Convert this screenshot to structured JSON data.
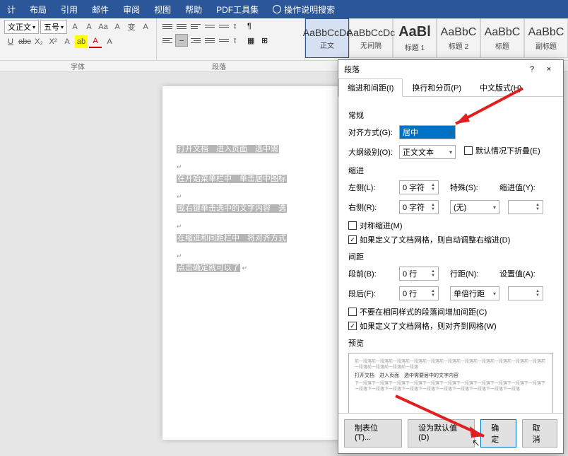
{
  "menu": {
    "items": [
      "计",
      "布局",
      "引用",
      "邮件",
      "审阅",
      "视图",
      "帮助",
      "PDF工具集"
    ],
    "search_hint": "操作说明搜索"
  },
  "ribbon": {
    "font_sel": "文正文",
    "size_sel": "五号",
    "btns_row1": [
      "A",
      "A",
      "Aa",
      "A",
      "变",
      "A"
    ],
    "btns_row2": [
      "U",
      "abc",
      "X₂",
      "X²",
      "A",
      "A",
      "A"
    ],
    "group_font": "字体",
    "group_para": "段落",
    "styles": [
      {
        "preview": "AaBbCcDc",
        "label": "正文",
        "big": false
      },
      {
        "preview": "AaBbCcDc",
        "label": "无间隔",
        "big": false
      },
      {
        "preview": "AaBl",
        "label": "标题 1",
        "big": true
      },
      {
        "preview": "AaBbC",
        "label": "标题 2",
        "big": false
      },
      {
        "preview": "AaBbC",
        "label": "标题",
        "big": false
      },
      {
        "preview": "AaBbC",
        "label": "副标题",
        "big": false
      }
    ]
  },
  "doc": {
    "lines": [
      "打开文档　进入页面　选中需",
      "在开始菜单栏中　单击居中图标",
      "或右键单击选中的文字内容　选",
      "在缩进和间距栏中　将对齐方式",
      "点击确定就可以了"
    ]
  },
  "dialog": {
    "title": "段落",
    "help": "?",
    "close": "×",
    "tabs": [
      "缩进和间距(I)",
      "换行和分页(P)",
      "中文版式(H)"
    ],
    "sec_general": "常规",
    "align_lbl": "对齐方式(G):",
    "align_val": "居中",
    "outline_lbl": "大纲级别(O):",
    "outline_val": "正文文本",
    "collapse_lbl": "默认情况下折叠(E)",
    "sec_indent": "缩进",
    "left_lbl": "左侧(L):",
    "left_val": "0 字符",
    "right_lbl": "右侧(R):",
    "right_val": "0 字符",
    "special_lbl": "特殊(S):",
    "special_val": "(无)",
    "indent_val_lbl": "缩进值(Y):",
    "sym_indent": "对称缩进(M)",
    "auto_right": "如果定义了文档网格，则自动调整右缩进(D)",
    "sec_spacing": "间距",
    "before_lbl": "段前(B):",
    "before_val": "0 行",
    "after_lbl": "段后(F):",
    "after_val": "0 行",
    "line_lbl": "行距(N):",
    "line_val": "单倍行距",
    "set_val_lbl": "设置值(A):",
    "no_space_same": "不要在相同样式的段落间增加间距(C)",
    "snap_grid": "如果定义了文档网格，则对齐到网格(W)",
    "sec_preview": "预览",
    "preview_text1": "前一段落前一段落前一段落前一段落前一段落前一段落前一段落前一段落前一段落前一段落前一段落前一段落前一段落前一段落前一段落",
    "preview_mid": "打开文档　进入页面　选中需要居中的文字内容",
    "preview_text2": "下一段落下一段落下一段落下一段落下一段落下一段落下一段落下一段落下一段落下一段落下一段落下一段落下一段落下一段落下一段落下一段落下一段落下一段落下一段落下一段落下一段落",
    "btn_tabs": "制表位(T)...",
    "btn_default": "设为默认值(D)",
    "btn_ok": "确定",
    "btn_cancel": "取消"
  }
}
